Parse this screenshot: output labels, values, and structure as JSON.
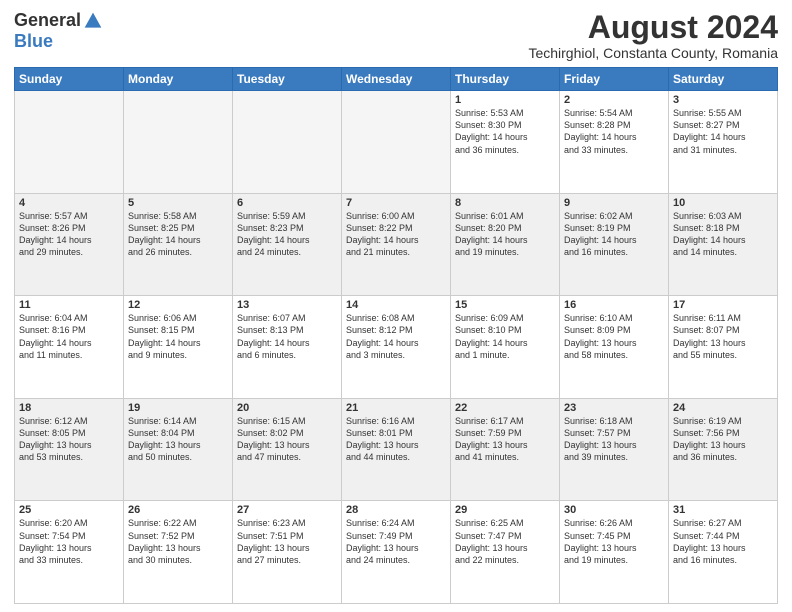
{
  "header": {
    "logo_general": "General",
    "logo_blue": "Blue",
    "month_year": "August 2024",
    "location": "Techirghiol, Constanta County, Romania"
  },
  "days_of_week": [
    "Sunday",
    "Monday",
    "Tuesday",
    "Wednesday",
    "Thursday",
    "Friday",
    "Saturday"
  ],
  "weeks": [
    [
      {
        "day": "",
        "info": ""
      },
      {
        "day": "",
        "info": ""
      },
      {
        "day": "",
        "info": ""
      },
      {
        "day": "",
        "info": ""
      },
      {
        "day": "1",
        "info": "Sunrise: 5:53 AM\nSunset: 8:30 PM\nDaylight: 14 hours\nand 36 minutes."
      },
      {
        "day": "2",
        "info": "Sunrise: 5:54 AM\nSunset: 8:28 PM\nDaylight: 14 hours\nand 33 minutes."
      },
      {
        "day": "3",
        "info": "Sunrise: 5:55 AM\nSunset: 8:27 PM\nDaylight: 14 hours\nand 31 minutes."
      }
    ],
    [
      {
        "day": "4",
        "info": "Sunrise: 5:57 AM\nSunset: 8:26 PM\nDaylight: 14 hours\nand 29 minutes."
      },
      {
        "day": "5",
        "info": "Sunrise: 5:58 AM\nSunset: 8:25 PM\nDaylight: 14 hours\nand 26 minutes."
      },
      {
        "day": "6",
        "info": "Sunrise: 5:59 AM\nSunset: 8:23 PM\nDaylight: 14 hours\nand 24 minutes."
      },
      {
        "day": "7",
        "info": "Sunrise: 6:00 AM\nSunset: 8:22 PM\nDaylight: 14 hours\nand 21 minutes."
      },
      {
        "day": "8",
        "info": "Sunrise: 6:01 AM\nSunset: 8:20 PM\nDaylight: 14 hours\nand 19 minutes."
      },
      {
        "day": "9",
        "info": "Sunrise: 6:02 AM\nSunset: 8:19 PM\nDaylight: 14 hours\nand 16 minutes."
      },
      {
        "day": "10",
        "info": "Sunrise: 6:03 AM\nSunset: 8:18 PM\nDaylight: 14 hours\nand 14 minutes."
      }
    ],
    [
      {
        "day": "11",
        "info": "Sunrise: 6:04 AM\nSunset: 8:16 PM\nDaylight: 14 hours\nand 11 minutes."
      },
      {
        "day": "12",
        "info": "Sunrise: 6:06 AM\nSunset: 8:15 PM\nDaylight: 14 hours\nand 9 minutes."
      },
      {
        "day": "13",
        "info": "Sunrise: 6:07 AM\nSunset: 8:13 PM\nDaylight: 14 hours\nand 6 minutes."
      },
      {
        "day": "14",
        "info": "Sunrise: 6:08 AM\nSunset: 8:12 PM\nDaylight: 14 hours\nand 3 minutes."
      },
      {
        "day": "15",
        "info": "Sunrise: 6:09 AM\nSunset: 8:10 PM\nDaylight: 14 hours\nand 1 minute."
      },
      {
        "day": "16",
        "info": "Sunrise: 6:10 AM\nSunset: 8:09 PM\nDaylight: 13 hours\nand 58 minutes."
      },
      {
        "day": "17",
        "info": "Sunrise: 6:11 AM\nSunset: 8:07 PM\nDaylight: 13 hours\nand 55 minutes."
      }
    ],
    [
      {
        "day": "18",
        "info": "Sunrise: 6:12 AM\nSunset: 8:05 PM\nDaylight: 13 hours\nand 53 minutes."
      },
      {
        "day": "19",
        "info": "Sunrise: 6:14 AM\nSunset: 8:04 PM\nDaylight: 13 hours\nand 50 minutes."
      },
      {
        "day": "20",
        "info": "Sunrise: 6:15 AM\nSunset: 8:02 PM\nDaylight: 13 hours\nand 47 minutes."
      },
      {
        "day": "21",
        "info": "Sunrise: 6:16 AM\nSunset: 8:01 PM\nDaylight: 13 hours\nand 44 minutes."
      },
      {
        "day": "22",
        "info": "Sunrise: 6:17 AM\nSunset: 7:59 PM\nDaylight: 13 hours\nand 41 minutes."
      },
      {
        "day": "23",
        "info": "Sunrise: 6:18 AM\nSunset: 7:57 PM\nDaylight: 13 hours\nand 39 minutes."
      },
      {
        "day": "24",
        "info": "Sunrise: 6:19 AM\nSunset: 7:56 PM\nDaylight: 13 hours\nand 36 minutes."
      }
    ],
    [
      {
        "day": "25",
        "info": "Sunrise: 6:20 AM\nSunset: 7:54 PM\nDaylight: 13 hours\nand 33 minutes."
      },
      {
        "day": "26",
        "info": "Sunrise: 6:22 AM\nSunset: 7:52 PM\nDaylight: 13 hours\nand 30 minutes."
      },
      {
        "day": "27",
        "info": "Sunrise: 6:23 AM\nSunset: 7:51 PM\nDaylight: 13 hours\nand 27 minutes."
      },
      {
        "day": "28",
        "info": "Sunrise: 6:24 AM\nSunset: 7:49 PM\nDaylight: 13 hours\nand 24 minutes."
      },
      {
        "day": "29",
        "info": "Sunrise: 6:25 AM\nSunset: 7:47 PM\nDaylight: 13 hours\nand 22 minutes."
      },
      {
        "day": "30",
        "info": "Sunrise: 6:26 AM\nSunset: 7:45 PM\nDaylight: 13 hours\nand 19 minutes."
      },
      {
        "day": "31",
        "info": "Sunrise: 6:27 AM\nSunset: 7:44 PM\nDaylight: 13 hours\nand 16 minutes."
      }
    ]
  ]
}
